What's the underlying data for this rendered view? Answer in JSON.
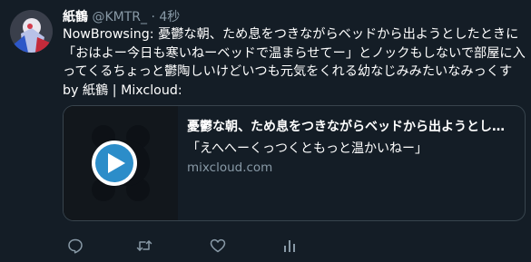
{
  "tweet": {
    "author_name": "紙鶴",
    "author_handle": "@KMTR_",
    "separator": "·",
    "time": "4秒",
    "text_lines": [
      "NowBrowsing: 憂鬱な朝、ため息をつきながらベッドから出ようとしたときに",
      "「おはよー今日も寒いねーベッドで温まらせてー」とノックもしないで部屋に入",
      "ってくるちょっと鬱陶しいけどいつも元気をくれる幼なじみみたいなみっくす",
      "by 紙鶴 | Mixcloud:"
    ]
  },
  "card": {
    "title": "憂鬱な朝、ため息をつきながらベッドから出ようとし…",
    "description": "「えへへーくっつくともっと温かいねー」",
    "domain": "mixcloud.com"
  },
  "actions": {
    "reply_icon": "reply-icon",
    "retweet_icon": "retweet-icon",
    "like_icon": "like-icon",
    "analytics_icon": "analytics-icon"
  },
  "colors": {
    "background": "#141d26",
    "text": "#ffffff",
    "secondary_text": "#8899a6",
    "border": "#38444d",
    "play_button": "#2c8dc9"
  }
}
